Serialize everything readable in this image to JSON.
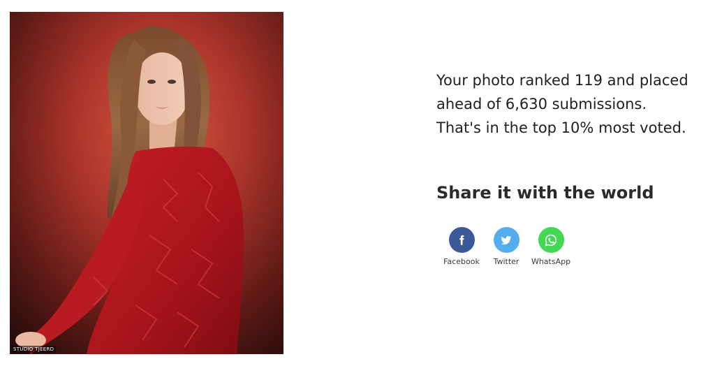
{
  "photo": {
    "alt": "Portrait of a girl in a red dress",
    "watermark": "STUDIO TJEERD"
  },
  "result": {
    "line1": "Your photo ranked 119 and placed",
    "line2": "ahead of 6,630 submissions.",
    "line3": "That's in the top 10% most voted."
  },
  "share": {
    "heading": "Share it with the world",
    "buttons": [
      {
        "label": "Facebook",
        "icon": "facebook-icon",
        "color": "#3b5998"
      },
      {
        "label": "Twitter",
        "icon": "twitter-icon",
        "color": "#55acee"
      },
      {
        "label": "WhatsApp",
        "icon": "whatsapp-icon",
        "color": "#43d854"
      }
    ]
  },
  "colors": {
    "text": "#1f1f1f",
    "heading": "#2b2b2b"
  }
}
